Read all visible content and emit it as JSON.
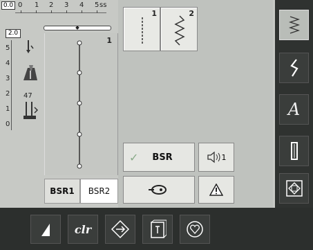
{
  "ruler": {
    "box": "0.0",
    "numbers": [
      "0",
      "1",
      "2",
      "3",
      "4",
      "5"
    ],
    "unit": "ss"
  },
  "scale": {
    "box": "2.0",
    "labels": [
      "5",
      "4",
      "3",
      "2",
      "1",
      "0"
    ]
  },
  "left_icons": {
    "tension_value": "47"
  },
  "stitch_panel": {
    "number": "1"
  },
  "stitch_buttons": [
    {
      "number": "1",
      "icon": "straight-stitch-icon"
    },
    {
      "number": "2",
      "icon": "zigzag-stitch-icon"
    }
  ],
  "tabs": {
    "bsr1": "BSR1",
    "bsr2": "BSR2"
  },
  "controls": {
    "bsr_label": "BSR",
    "check_icon": "checkmark-icon",
    "sound_icon": "speaker-icon",
    "sound_value": "1",
    "foot_icon": "presser-foot-icon",
    "warning_icon": "warning-icon"
  },
  "sidebar": [
    {
      "icon": "practical-stitch-icon",
      "active": true
    },
    {
      "icon": "decorative-stitch-icon",
      "active": false
    },
    {
      "icon": "alphabet-icon",
      "label": "A",
      "active": false
    },
    {
      "icon": "buttonhole-icon",
      "active": false
    },
    {
      "icon": "quilt-icon",
      "active": false
    },
    {
      "icon": "setup-icon",
      "active": false
    }
  ],
  "bottom": [
    {
      "icon": "needle-position-icon"
    },
    {
      "icon": "clear-icon",
      "label": "clr"
    },
    {
      "icon": "balance-icon"
    },
    {
      "icon": "memory-icon"
    },
    {
      "icon": "favorite-icon"
    }
  ],
  "colors": {
    "background": "#c7c9c5",
    "sidebar": "#2f3230",
    "active_button": "#b9bdb8"
  }
}
